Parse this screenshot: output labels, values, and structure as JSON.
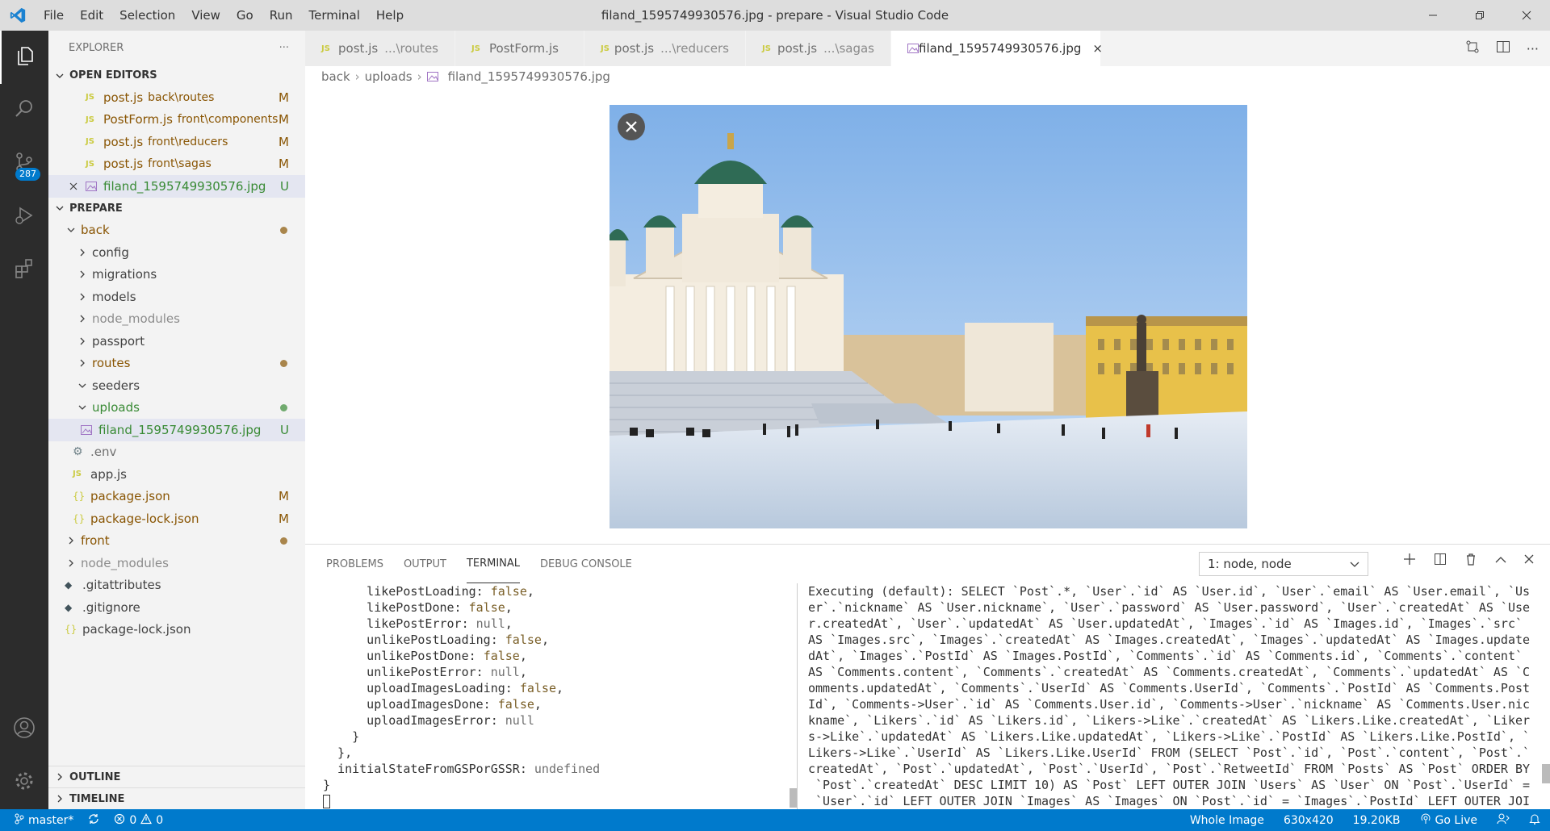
{
  "window": {
    "title": "filand_1595749930576.jpg - prepare - Visual Studio Code",
    "menu": [
      "File",
      "Edit",
      "Selection",
      "View",
      "Go",
      "Run",
      "Terminal",
      "Help"
    ]
  },
  "activity_bar": {
    "scm_badge": "287"
  },
  "explorer": {
    "header": "EXPLORER",
    "more": "···",
    "open_editors_label": "OPEN EDITORS",
    "open_editors": [
      {
        "name": "post.js",
        "desc": "back\\routes",
        "status": "M"
      },
      {
        "name": "PostForm.js",
        "desc": "front\\components",
        "status": "M"
      },
      {
        "name": "post.js",
        "desc": "front\\reducers",
        "status": "M"
      },
      {
        "name": "post.js",
        "desc": "front\\sagas",
        "status": "M"
      },
      {
        "name": "filand_1595749930576.jpg",
        "desc": "",
        "status": "U"
      }
    ],
    "workspace_label": "PREPARE",
    "tree": {
      "back": "back",
      "config": "config",
      "migrations": "migrations",
      "models": "models",
      "node_modules_back": "node_modules",
      "passport": "passport",
      "routes": "routes",
      "seeders": "seeders",
      "uploads": "uploads",
      "upload_file": "filand_1595749930576.jpg",
      "upload_file_status": "U",
      "env": ".env",
      "app": "app.js",
      "package": "package.json",
      "package_status": "M",
      "package_lock": "package-lock.json",
      "package_lock_status": "M",
      "front": "front",
      "node_modules": "node_modules",
      "gitattributes": ".gitattributes",
      "gitignore": ".gitignore",
      "root_package_lock": "package-lock.json"
    },
    "outline_label": "OUTLINE",
    "timeline_label": "TIMELINE"
  },
  "tabs": [
    {
      "name": "post.js",
      "desc": "...\\routes"
    },
    {
      "name": "PostForm.js",
      "desc": ""
    },
    {
      "name": "post.js",
      "desc": "...\\reducers"
    },
    {
      "name": "post.js",
      "desc": "...\\sagas"
    },
    {
      "name": "filand_1595749930576.jpg",
      "desc": "",
      "close": "×"
    }
  ],
  "breadcrumb": [
    "back",
    "uploads",
    "filand_1595749930576.jpg"
  ],
  "panel": {
    "tabs": [
      "PROBLEMS",
      "OUTPUT",
      "TERMINAL",
      "DEBUG CONSOLE"
    ],
    "terminal_select": "1: node, node",
    "left_lines": [
      {
        "indent": "      ",
        "key": "likePostLoading: ",
        "val": "false",
        "type": "bool",
        "end": ","
      },
      {
        "indent": "      ",
        "key": "likePostDone: ",
        "val": "false",
        "type": "bool",
        "end": ","
      },
      {
        "indent": "      ",
        "key": "likePostError: ",
        "val": "null",
        "type": "null",
        "end": ","
      },
      {
        "indent": "      ",
        "key": "unlikePostLoading: ",
        "val": "false",
        "type": "bool",
        "end": ","
      },
      {
        "indent": "      ",
        "key": "unlikePostDone: ",
        "val": "false",
        "type": "bool",
        "end": ","
      },
      {
        "indent": "      ",
        "key": "unlikePostError: ",
        "val": "null",
        "type": "null",
        "end": ","
      },
      {
        "indent": "      ",
        "key": "uploadImagesLoading: ",
        "val": "false",
        "type": "bool",
        "end": ","
      },
      {
        "indent": "      ",
        "key": "uploadImagesDone: ",
        "val": "false",
        "type": "bool",
        "end": ","
      },
      {
        "indent": "      ",
        "key": "uploadImagesError: ",
        "val": "null",
        "type": "null",
        "end": ""
      },
      {
        "indent": "    ",
        "key": "}",
        "val": "",
        "type": "",
        "end": ""
      },
      {
        "indent": "  ",
        "key": "},",
        "val": "",
        "type": "",
        "end": ""
      },
      {
        "indent": "  ",
        "key": "initialStateFromGSPorGSSR: ",
        "val": "undefined",
        "type": "null",
        "end": ""
      },
      {
        "indent": "",
        "key": "}",
        "val": "",
        "type": "",
        "end": ""
      }
    ],
    "right_lines": [
      "Executing (default): SELECT `Post`.*, `User`.`id` AS `User.id`, `User`.`email` AS `User.email`, `Us",
      "er`.`nickname` AS `User.nickname`, `User`.`password` AS `User.password`, `User`.`createdAt` AS `Use",
      "r.createdAt`, `User`.`updatedAt` AS `User.updatedAt`, `Images`.`id` AS `Images.id`, `Images`.`src`",
      "AS `Images.src`, `Images`.`createdAt` AS `Images.createdAt`, `Images`.`updatedAt` AS `Images.update",
      "dAt`, `Images`.`PostId` AS `Images.PostId`, `Comments`.`id` AS `Comments.id`, `Comments`.`content`",
      "AS `Comments.content`, `Comments`.`createdAt` AS `Comments.createdAt`, `Comments`.`updatedAt` AS `C",
      "omments.updatedAt`, `Comments`.`UserId` AS `Comments.UserId`, `Comments`.`PostId` AS `Comments.Post",
      "Id`, `Comments->User`.`id` AS `Comments.User.id`, `Comments->User`.`nickname` AS `Comments.User.nic",
      "kname`, `Likers`.`id` AS `Likers.id`, `Likers->Like`.`createdAt` AS `Likers.Like.createdAt`, `Liker",
      "s->Like`.`updatedAt` AS `Likers.Like.updatedAt`, `Likers->Like`.`PostId` AS `Likers.Like.PostId`, `",
      "Likers->Like`.`UserId` AS `Likers.Like.UserId` FROM (SELECT `Post`.`id`, `Post`.`content`, `Post`.`",
      "createdAt`, `Post`.`updatedAt`, `Post`.`UserId`, `Post`.`RetweetId` FROM `Posts` AS `Post` ORDER BY",
      " `Post`.`createdAt` DESC LIMIT 10) AS `Post` LEFT OUTER JOIN `Users` AS `User` ON `Post`.`UserId` =",
      " `User`.`id` LEFT OUTER JOIN `Images` AS `Images` ON `Post`.`id` = `Images`.`PostId` LEFT OUTER JOI"
    ]
  },
  "statusbar": {
    "branch": "master*",
    "errors": "0",
    "warnings": "0",
    "image_mode": "Whole Image",
    "dimensions": "630x420",
    "size": "19.20KB",
    "go_live": "Go Live"
  },
  "colors": {
    "accent": "#007acc",
    "modified": "#895503",
    "untracked": "#388a34",
    "activity_bar": "#2c2c2c"
  }
}
